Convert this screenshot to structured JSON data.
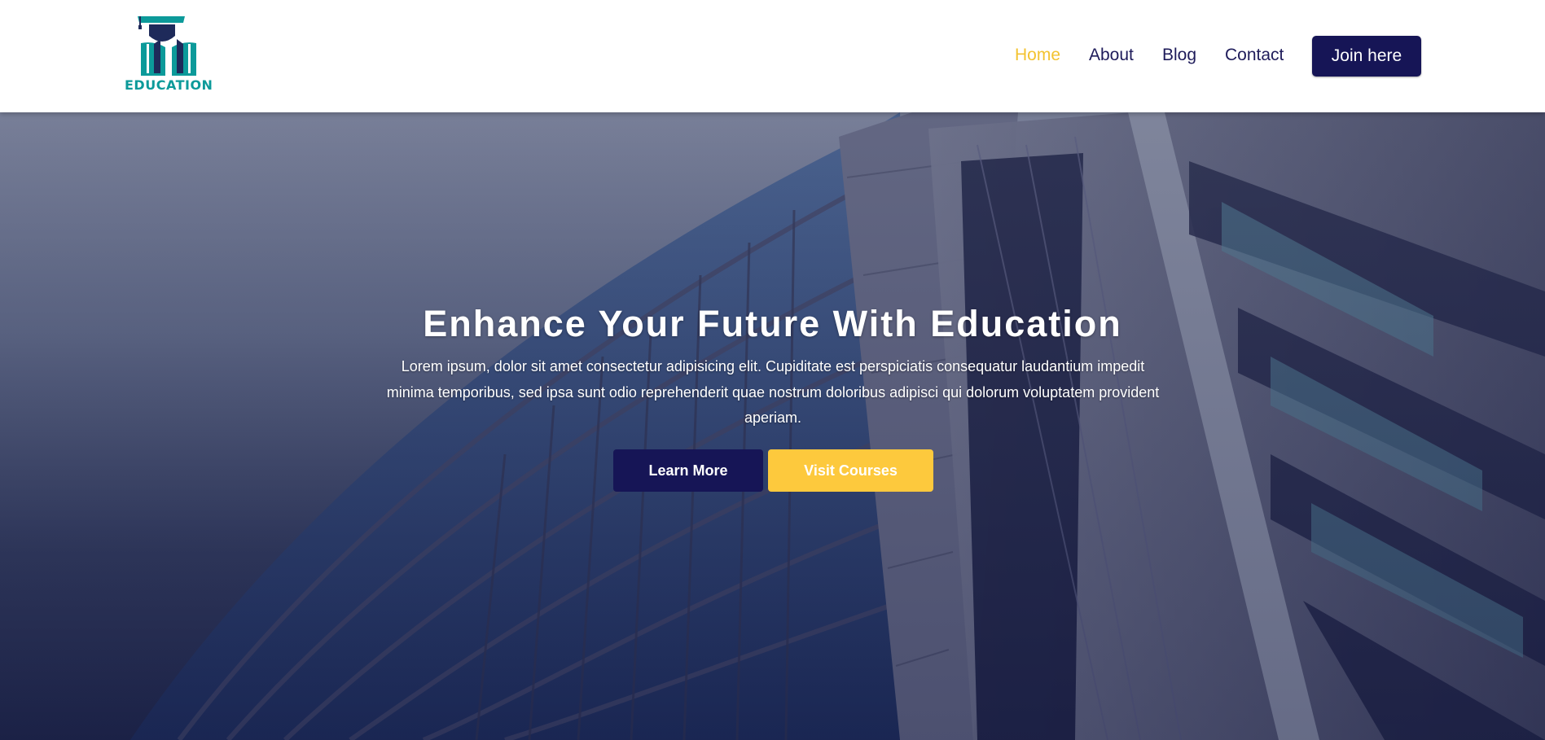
{
  "brand": {
    "logo_text": "EDUCATION",
    "logo_icon": "graduation-book-icon",
    "color": "#0c9a9a"
  },
  "nav": {
    "items": [
      {
        "label": "Home",
        "active": true
      },
      {
        "label": "About",
        "active": false
      },
      {
        "label": "Blog",
        "active": false
      },
      {
        "label": "Contact",
        "active": false
      }
    ],
    "cta_label": "Join here",
    "active_color": "#f3c331",
    "text_color": "#1e1b5a"
  },
  "hero": {
    "title": "Enhance Your Future With Education",
    "description": "Lorem ipsum, dolor sit amet consectetur adipisicing elit. Cupiditate est perspiciatis consequatur laudantium impedit minima temporibus, sed ipsa sunt odio reprehenderit quae nostrum doloribus adipisci qui dolorum voluptatem provident aperiam.",
    "primary_button": "Learn More",
    "secondary_button": "Visit Courses",
    "background": "building-photo"
  },
  "colors": {
    "primary": "#161556",
    "accent": "#fdc93d"
  }
}
